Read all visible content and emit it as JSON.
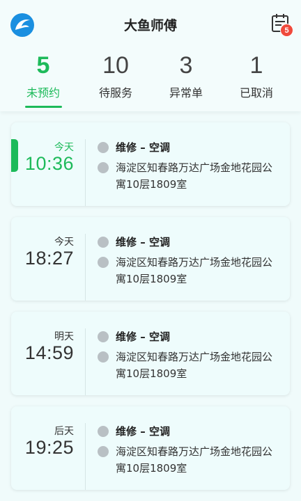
{
  "header": {
    "title": "大鱼师傅",
    "logo_icon": "dolphin-logo-icon",
    "calendar_icon": "calendar-icon",
    "calendar_badge": "5"
  },
  "tabs": [
    {
      "count": "5",
      "label": "未预约",
      "active": true
    },
    {
      "count": "10",
      "label": "待服务",
      "active": false
    },
    {
      "count": "3",
      "label": "异常单",
      "active": false
    },
    {
      "count": "1",
      "label": "已取消",
      "active": false
    }
  ],
  "orders": [
    {
      "day": "今天",
      "time": "10:36",
      "service": "维修 – 空调",
      "address": "海淀区知春路万达广场金地花园公寓10层1809室"
    },
    {
      "day": "今天",
      "time": "18:27",
      "service": "维修 – 空调",
      "address": "海淀区知春路万达广场金地花园公寓10层1809室"
    },
    {
      "day": "明天",
      "time": "14:59",
      "service": "维修 – 空调",
      "address": "海淀区知春路万达广场金地花园公寓10层1809室"
    },
    {
      "day": "后天",
      "time": "19:25",
      "service": "维修 – 空调",
      "address": "海淀区知春路万达广场金地花园公寓10层1809室"
    }
  ],
  "colors": {
    "accent": "#1dba5a",
    "brand_blue": "#1a8fe0",
    "badge_red": "#ef4a3c"
  }
}
